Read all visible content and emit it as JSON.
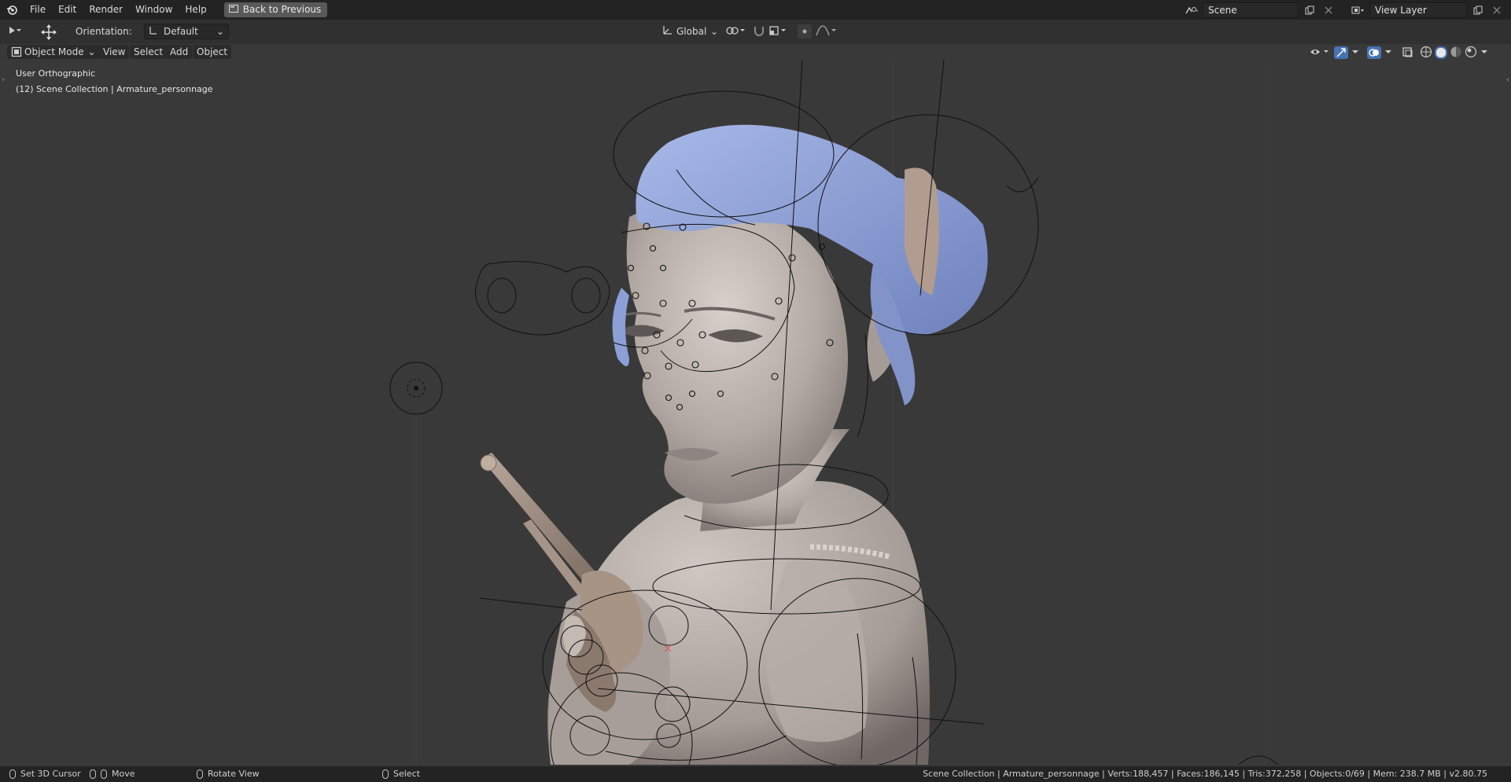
{
  "menubar": {
    "items": [
      "File",
      "Edit",
      "Render",
      "Window",
      "Help"
    ],
    "back_button": "Back to Previous",
    "scene_value": "Scene",
    "view_layer_value": "View Layer"
  },
  "tool_header": {
    "orientation_label": "Orientation:",
    "orientation_value": "Default",
    "transform_orientation": "Global"
  },
  "viewport_header": {
    "mode": "Object Mode",
    "menus": [
      "View",
      "Select",
      "Add",
      "Object"
    ]
  },
  "viewport": {
    "view_name": "User Orthographic",
    "collection_info": "(12) Scene Collection | Armature_personnage"
  },
  "statusbar": {
    "left_click": "Set 3D Cursor",
    "middle": "Move",
    "right_drag": "Rotate View",
    "select": "Select",
    "stats": "Scene Collection | Armature_personnage | Verts:188,457 | Faces:186,145 | Tris:372,258 | Objects:0/69 | Mem: 238.7 MB | v2.80.75"
  },
  "colors": {
    "hair": "#8c9fd6",
    "skin": "#bcb2ad",
    "background": "#393939",
    "accent": "#4772b3"
  }
}
